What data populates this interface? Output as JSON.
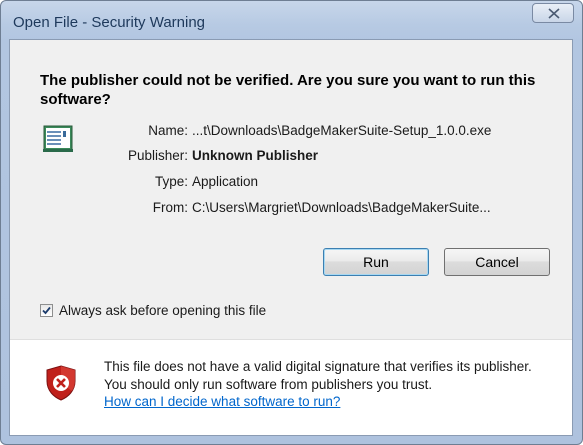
{
  "window": {
    "title": "Open File - Security Warning"
  },
  "headline": "The publisher could not be verified.  Are you sure you want to run this software?",
  "details": {
    "name_label": "Name:",
    "name_value": "...t\\Downloads\\BadgeMakerSuite-Setup_1.0.0.exe",
    "publisher_label": "Publisher:",
    "publisher_value": "Unknown Publisher",
    "type_label": "Type:",
    "type_value": "Application",
    "from_label": "From:",
    "from_value": "C:\\Users\\Margriet\\Downloads\\BadgeMakerSuite..."
  },
  "buttons": {
    "run": "Run",
    "cancel": "Cancel"
  },
  "always_ask": {
    "label": "Always ask before opening this file",
    "checked": true
  },
  "warning": {
    "text": "This file does not have a valid digital signature that verifies its publisher.  You should only run software from publishers you trust.",
    "link": "How can I decide what software to run?"
  },
  "icons": {
    "close": "close-icon",
    "app": "application-icon",
    "shield": "shield-error-icon",
    "check": "checkmark-icon"
  },
  "colors": {
    "link": "#0066cc",
    "shield_red": "#c0201b"
  }
}
